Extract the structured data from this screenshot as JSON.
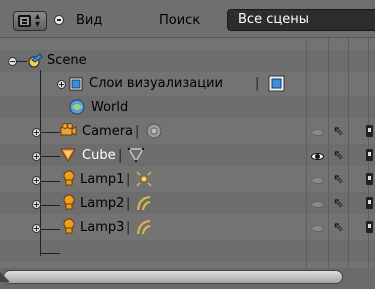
{
  "header": {
    "menu_view": "Вид",
    "menu_search": "Поиск",
    "scene_select": "Все сцены"
  },
  "tree": {
    "scene": "Scene",
    "render_layers": "Слои визуализации",
    "world": "World",
    "camera": "Camera",
    "cube": "Cube",
    "lamp1": "Lamp1",
    "lamp2": "Lamp2",
    "lamp3": "Lamp3",
    "separator": "|"
  },
  "colors": {
    "background": "#737373",
    "dropdown_bg": "#2d2d2d",
    "selected_text": "#ffffff",
    "camera_icon": "#e8a33a",
    "cube_icon": "#f29a2e",
    "lamp_icon": "#f0a020",
    "world_icon": "#3c8fd6"
  },
  "icons": {
    "editor": "outliner-editor-icon",
    "scene": "scene-icon",
    "render_layers": "render-layers-icon",
    "world": "world-icon",
    "camera": "camera-object-icon",
    "cube": "mesh-object-icon",
    "lamp": "lamp-object-icon",
    "visibility": "eye-icon",
    "selectability": "cursor-arrow-icon",
    "renderability": "camera-render-icon"
  }
}
